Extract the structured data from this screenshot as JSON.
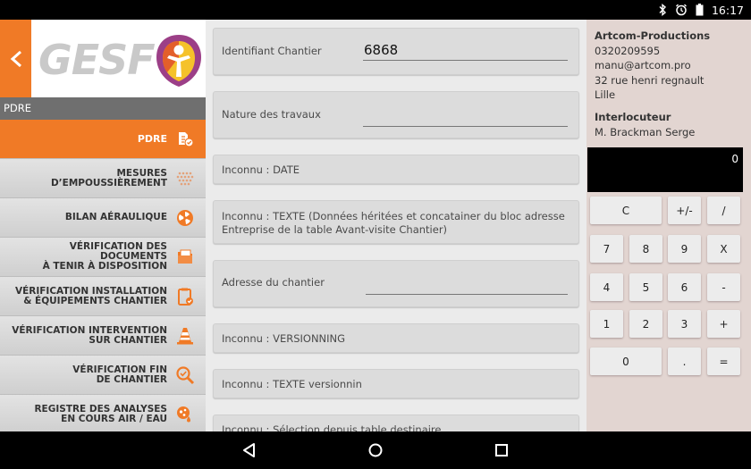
{
  "status_bar": {
    "time": "16:17"
  },
  "logo": {
    "text": "GESF"
  },
  "sidebar": {
    "section_title": "PDRE",
    "items": [
      {
        "label": "PDRE",
        "icon": "pdre-icon",
        "active": true
      },
      {
        "label": "MESURES\nD’EMPOUSSIÈREMENT",
        "icon": "dust-measure-icon"
      },
      {
        "label": "BILAN AÉRAULIQUE",
        "icon": "fan-icon"
      },
      {
        "label": "VÉRIFICATION DES DOCUMENTS\nÀ TENIR À DISPOSITION",
        "icon": "folder-icon"
      },
      {
        "label": "VÉRIFICATION INSTALLATION\n& ÉQUIPEMENTS CHANTIER",
        "icon": "clipboard-check-icon"
      },
      {
        "label": "VÉRIFICATION INTERVENTION\nSUR CHANTIER",
        "icon": "traffic-cone-icon"
      },
      {
        "label": "VÉRIFICATION FIN\nDE CHANTIER",
        "icon": "magnifier-check-icon"
      },
      {
        "label": "REGISTRE DES ANALYSES\nEN COURS AIR / EAU",
        "icon": "analysis-icon"
      }
    ]
  },
  "form": {
    "fields": [
      {
        "label": "Identifiant Chantier",
        "value": "6868",
        "has_input": true
      },
      {
        "label": "Nature des travaux",
        "value": "",
        "has_input": true
      },
      {
        "label": "Inconnu : DATE",
        "value": "",
        "has_input": false
      },
      {
        "label": "Inconnu : TEXTE (Données héritées et concatainer du bloc adresse\nEntreprise de la table Avant-visite Chantier)",
        "value": "",
        "has_input": false
      },
      {
        "label": "Adresse du chantier",
        "value": "",
        "has_input": true
      },
      {
        "label": "Inconnu : VERSIONNING",
        "value": "",
        "has_input": false
      },
      {
        "label": "Inconnu : TEXTE versionnin",
        "value": "",
        "has_input": false
      },
      {
        "label": "Inconnu : Sélection depuis table destinaire",
        "value": "",
        "has_input": false
      }
    ]
  },
  "contact": {
    "company": "Artcom-Productions",
    "phone": "0320209595",
    "email": "manu@artcom.pro",
    "address": "32 rue henri regnault",
    "city": "Lille",
    "interlocutor_label": "Interlocuteur",
    "interlocutor_name": "M. Brackman Serge"
  },
  "calculator": {
    "display": "0",
    "keys": [
      "C",
      "+/-",
      "/",
      "7",
      "8",
      "9",
      "X",
      "4",
      "5",
      "6",
      "-",
      "1",
      "2",
      "3",
      "+",
      "0",
      ".",
      "="
    ]
  },
  "colors": {
    "accent": "#f07a26",
    "right_panel": "#e2d5d1",
    "header_gray": "#6f6f6f"
  }
}
